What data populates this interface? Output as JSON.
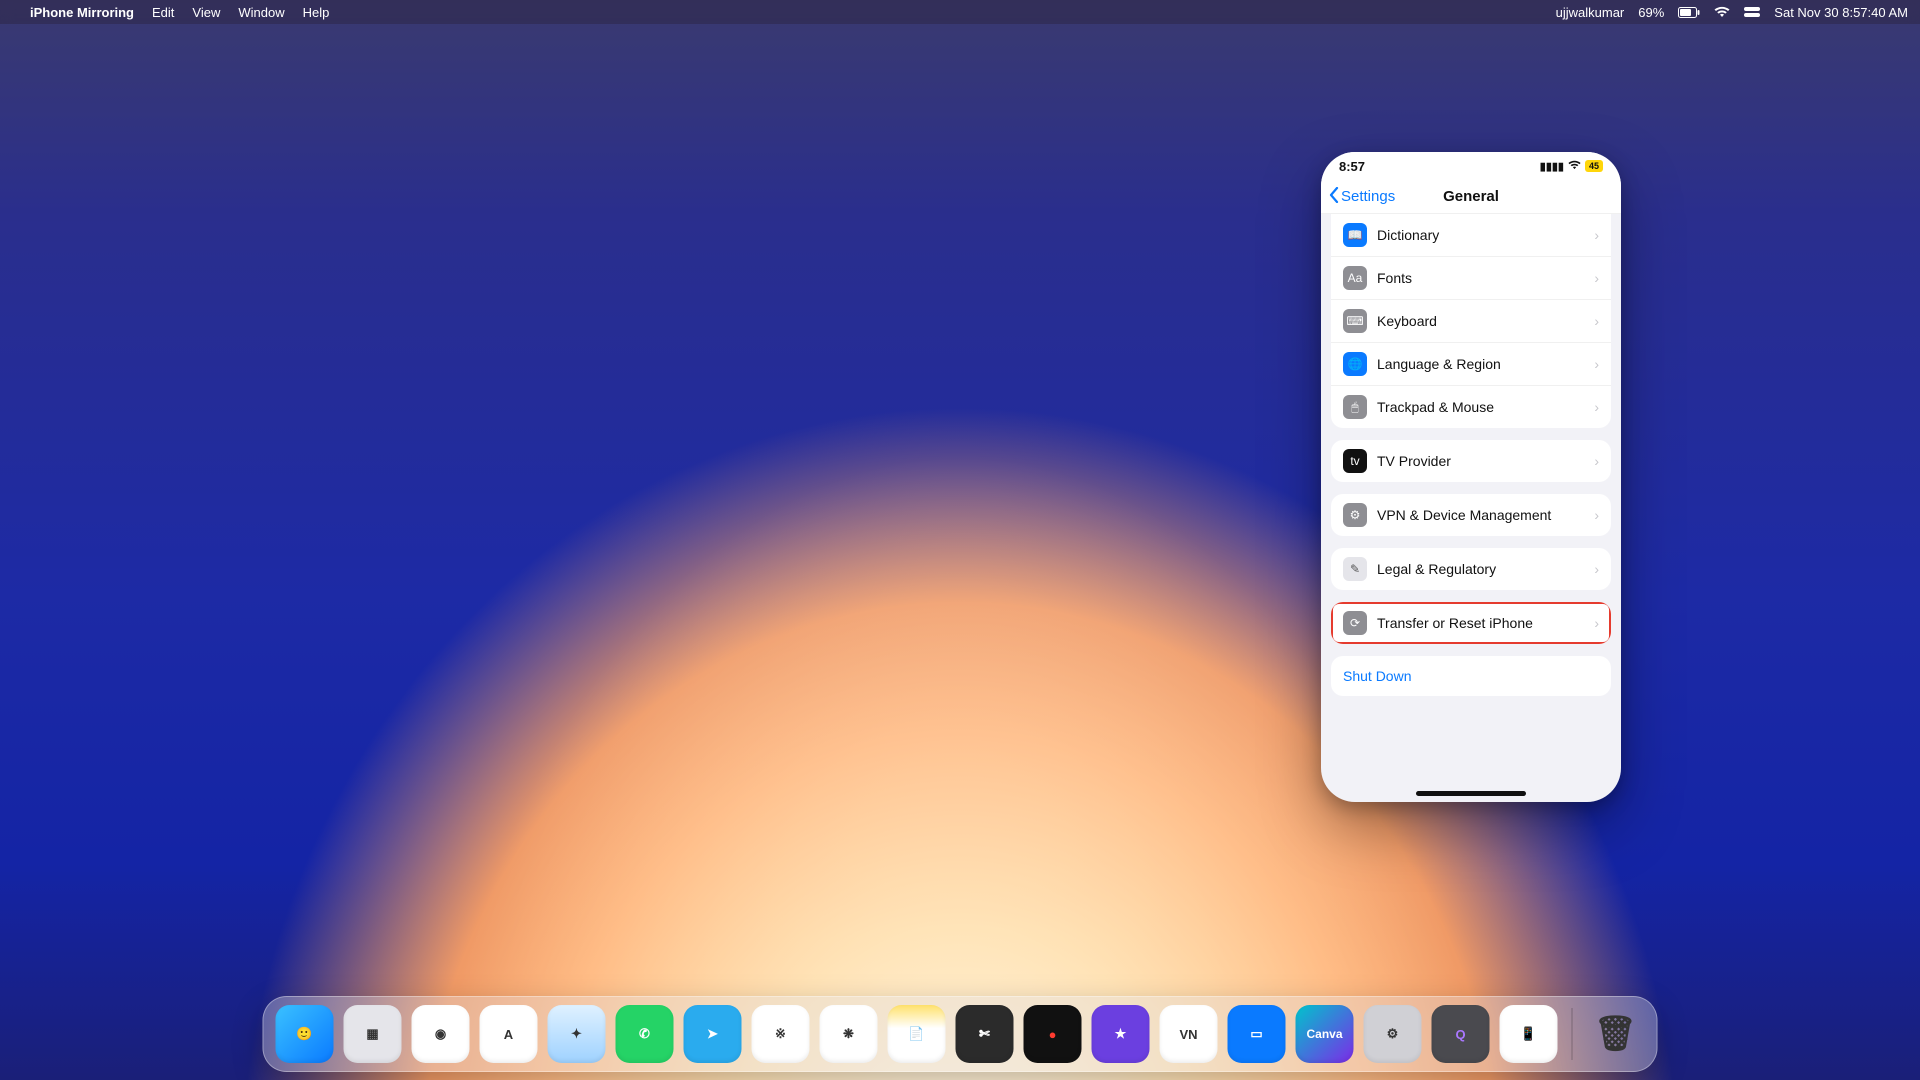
{
  "menubar": {
    "app_name": "iPhone Mirroring",
    "items": [
      "Edit",
      "View",
      "Window",
      "Help"
    ],
    "user": "ujjwalkumar",
    "battery": "69%",
    "datetime": "Sat Nov 30  8:57:40 AM"
  },
  "phone": {
    "time": "8:57",
    "battery_badge": "45",
    "back_label": "Settings",
    "title": "General",
    "groups": [
      {
        "first": true,
        "rows": [
          {
            "id": "dictionary",
            "label": "Dictionary",
            "icon_bg": "#0a7aff",
            "icon_glyph": "📖"
          },
          {
            "id": "fonts",
            "label": "Fonts",
            "icon_bg": "#8e8e93",
            "icon_glyph": "Aa"
          },
          {
            "id": "keyboard",
            "label": "Keyboard",
            "icon_bg": "#8e8e93",
            "icon_glyph": "⌨︎"
          },
          {
            "id": "language-region",
            "label": "Language & Region",
            "icon_bg": "#0a7aff",
            "icon_glyph": "🌐"
          },
          {
            "id": "trackpad-mouse",
            "label": "Trackpad & Mouse",
            "icon_bg": "#8e8e93",
            "icon_glyph": "🖱"
          }
        ]
      },
      {
        "rows": [
          {
            "id": "tv-provider",
            "label": "TV Provider",
            "icon_bg": "#111111",
            "icon_glyph": "tv"
          }
        ]
      },
      {
        "rows": [
          {
            "id": "vpn-device-mgmt",
            "label": "VPN & Device Management",
            "icon_bg": "#8e8e93",
            "icon_glyph": "⚙︎"
          }
        ]
      },
      {
        "rows": [
          {
            "id": "legal-regulatory",
            "label": "Legal & Regulatory",
            "icon_bg": "#e5e5ea",
            "icon_fg": "#555",
            "icon_glyph": "✎"
          }
        ]
      },
      {
        "rows": [
          {
            "id": "transfer-reset",
            "label": "Transfer or Reset iPhone",
            "icon_bg": "#8e8e93",
            "icon_glyph": "⟳",
            "highlight": true
          }
        ]
      },
      {
        "rows": [
          {
            "id": "shut-down",
            "label": "Shut Down",
            "shutdown": true
          }
        ]
      }
    ]
  },
  "dock": {
    "items": [
      {
        "id": "finder",
        "label": "🙂",
        "bg": "linear-gradient(135deg,#3ac1ff,#0a7aff)"
      },
      {
        "id": "launchpad",
        "label": "▦",
        "bg": "#e5e5ea"
      },
      {
        "id": "chrome",
        "label": "◉",
        "bg": "#ffffff"
      },
      {
        "id": "arc",
        "label": "A",
        "bg": "#ffffff"
      },
      {
        "id": "safari",
        "label": "✦",
        "bg": "linear-gradient(180deg,#dff1ff,#9fd2ff)"
      },
      {
        "id": "whatsapp",
        "label": "✆",
        "bg": "#25D366",
        "fg": "#fff"
      },
      {
        "id": "telegram",
        "label": "➤",
        "bg": "#2AABEE",
        "fg": "#fff"
      },
      {
        "id": "slack",
        "label": "※",
        "bg": "#ffffff"
      },
      {
        "id": "chatgpt",
        "label": "❋",
        "bg": "#ffffff"
      },
      {
        "id": "notes",
        "label": "📄",
        "bg": "linear-gradient(180deg,#ffe16b,#ffffff 40%)"
      },
      {
        "id": "fcpx",
        "label": "✄",
        "bg": "#2b2b2b",
        "fg": "#fff"
      },
      {
        "id": "voice-memos",
        "label": "●",
        "bg": "#111",
        "fg": "#ff3b30"
      },
      {
        "id": "imovie",
        "label": "★",
        "bg": "#6b3fe0",
        "fg": "#fff"
      },
      {
        "id": "vn",
        "label": "VN",
        "bg": "#ffffff"
      },
      {
        "id": "keynote",
        "label": "▭",
        "bg": "#0a7aff",
        "fg": "#fff"
      },
      {
        "id": "canva",
        "label": "Canva",
        "bg": "linear-gradient(135deg,#00c4cc,#7d2ae8)",
        "fg": "#fff"
      },
      {
        "id": "system-settings",
        "label": "⚙︎",
        "bg": "#d0d0d5"
      },
      {
        "id": "quicktime",
        "label": "Q",
        "bg": "#4a4a4f",
        "fg": "#a7f"
      },
      {
        "id": "iphone-mirroring",
        "label": "📱",
        "bg": "#ffffff"
      }
    ],
    "trash": {
      "id": "trash",
      "label": "🗑",
      "bg": "transparent"
    }
  }
}
